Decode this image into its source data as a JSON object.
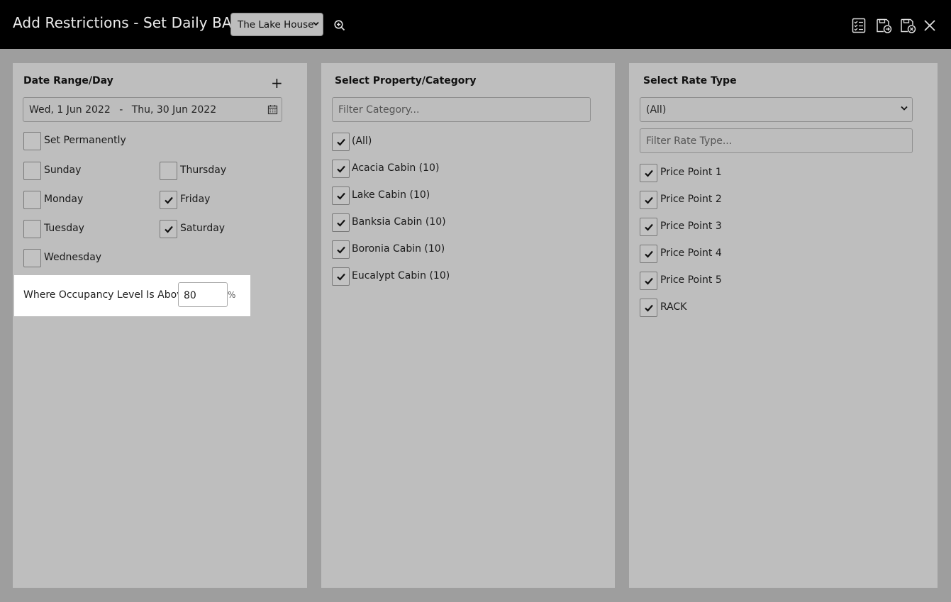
{
  "header": {
    "title": "Add Restrictions - Set Daily BAR",
    "property_selected": "The Lake House"
  },
  "date_panel": {
    "title": "Date Range/Day",
    "add_label": "+",
    "date_from": "Wed, 1 Jun 2022",
    "date_sep": "-",
    "date_to": "Thu, 30 Jun 2022",
    "set_permanently": "Set Permanently",
    "days": {
      "sunday": "Sunday",
      "monday": "Monday",
      "tuesday": "Tuesday",
      "wednesday": "Wednesday",
      "thursday": "Thursday",
      "friday": "Friday",
      "saturday": "Saturday"
    },
    "occupancy_label": "Where Occupancy Level Is Above",
    "occupancy_value": "80",
    "occupancy_unit": "%"
  },
  "category_panel": {
    "title": "Select Property/Category",
    "filter_placeholder": "Filter Category...",
    "items": [
      "(All)",
      "Acacia Cabin (10)",
      "Lake Cabin (10)",
      "Banksia Cabin (10)",
      "Boronia Cabin (10)",
      "Eucalypt Cabin (10)"
    ]
  },
  "rate_panel": {
    "title": "Select Rate Type",
    "rate_select": "(All)",
    "filter_placeholder": "Filter Rate Type...",
    "items": [
      "Price Point 1",
      "Price Point 2",
      "Price Point 3",
      "Price Point 4",
      "Price Point 5",
      "RACK"
    ]
  }
}
